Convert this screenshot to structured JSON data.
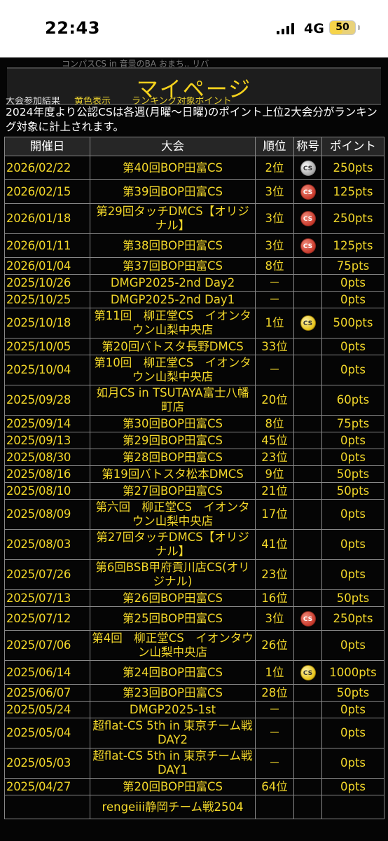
{
  "status_bar": {
    "time": "22:43",
    "network": "4G",
    "battery": "50",
    "battery_level": 0.5
  },
  "page": {
    "ghost_text": "コンパスCS in 音景のBA おまち.. リバ",
    "title": "マイページ",
    "legend": {
      "prefix": "大会参加結果",
      "yellow_label": "黄色表示",
      "ranking_label": "ランキング対象ポイント"
    },
    "notice": "2024年度より公認CSは各週(月曜～日曜)のポイント上位2大会分がランキング対象に計上されます。"
  },
  "table": {
    "headers": [
      "開催日",
      "大会",
      "順位",
      "称号",
      "ポイント"
    ],
    "rows": [
      {
        "date": "2026/02/22",
        "event": "第40回BOP田富CS",
        "rank": "2位",
        "badge": "silver",
        "badge_text": "CS",
        "points": "250pts"
      },
      {
        "date": "2026/02/15",
        "event": "第39回BOP田富CS",
        "rank": "3位",
        "badge": "bronze",
        "badge_text": "CS",
        "points": "125pts"
      },
      {
        "date": "2026/01/18",
        "event": "第29回タッチDMCS【オリジナル】",
        "rank": "3位",
        "badge": "bronze",
        "badge_text": "CS",
        "points": "250pts"
      },
      {
        "date": "2026/01/11",
        "event": "第38回BOP田富CS",
        "rank": "3位",
        "badge": "bronze",
        "badge_text": "CS",
        "points": "125pts"
      },
      {
        "date": "2026/01/04",
        "event": "第37回BOP田富CS",
        "rank": "8位",
        "badge": "",
        "badge_text": "",
        "points": "75pts"
      },
      {
        "date": "2025/10/26",
        "event": "DMGP2025-2nd Day2",
        "rank": "－",
        "badge": "",
        "badge_text": "",
        "points": "0pts"
      },
      {
        "date": "2025/10/25",
        "event": "DMGP2025-2nd Day1",
        "rank": "－",
        "badge": "",
        "badge_text": "",
        "points": "0pts"
      },
      {
        "date": "2025/10/18",
        "event": "第11回　柳正堂CS　イオンタウン山梨中央店",
        "rank": "1位",
        "badge": "gold",
        "badge_text": "CS",
        "points": "500pts"
      },
      {
        "date": "2025/10/05",
        "event": "第20回バトスタ長野DMCS",
        "rank": "33位",
        "badge": "",
        "badge_text": "",
        "points": "0pts"
      },
      {
        "date": "2025/10/04",
        "event": "第10回　柳正堂CS　イオンタウン山梨中央店",
        "rank": "－",
        "badge": "",
        "badge_text": "",
        "points": "0pts"
      },
      {
        "date": "2025/09/28",
        "event": "如月CS in TSUTAYA富士八幡町店",
        "rank": "20位",
        "badge": "",
        "badge_text": "",
        "points": "60pts"
      },
      {
        "date": "2025/09/14",
        "event": "第30回BOP田富CS",
        "rank": "8位",
        "badge": "",
        "badge_text": "",
        "points": "75pts"
      },
      {
        "date": "2025/09/13",
        "event": "第29回BOP田富CS",
        "rank": "45位",
        "badge": "",
        "badge_text": "",
        "points": "0pts"
      },
      {
        "date": "2025/08/30",
        "event": "第28回BOP田富CS",
        "rank": "23位",
        "badge": "",
        "badge_text": "",
        "points": "0pts"
      },
      {
        "date": "2025/08/16",
        "event": "第19回バトスタ松本DMCS",
        "rank": "9位",
        "badge": "",
        "badge_text": "",
        "points": "50pts"
      },
      {
        "date": "2025/08/10",
        "event": "第27回BOP田富CS",
        "rank": "21位",
        "badge": "",
        "badge_text": "",
        "points": "50pts"
      },
      {
        "date": "2025/08/09",
        "event": "第六回　柳正堂CS　イオンタウン山梨中央店",
        "rank": "17位",
        "badge": "",
        "badge_text": "",
        "points": "0pts"
      },
      {
        "date": "2025/08/03",
        "event": "第27回タッチDMCS【オリジナル】",
        "rank": "41位",
        "badge": "",
        "badge_text": "",
        "points": "0pts"
      },
      {
        "date": "2025/07/26",
        "event": "第6回BSB甲府貢川店CS(オリジナル)",
        "rank": "23位",
        "badge": "",
        "badge_text": "",
        "points": "0pts"
      },
      {
        "date": "2025/07/13",
        "event": "第26回BOP田富CS",
        "rank": "16位",
        "badge": "",
        "badge_text": "",
        "points": "50pts"
      },
      {
        "date": "2025/07/12",
        "event": "第25回BOP田富CS",
        "rank": "3位",
        "badge": "bronze",
        "badge_text": "CS",
        "points": "250pts"
      },
      {
        "date": "2025/07/06",
        "event": "第4回　柳正堂CS　イオンタウン山梨中央店",
        "rank": "26位",
        "badge": "",
        "badge_text": "",
        "points": "0pts"
      },
      {
        "date": "2025/06/14",
        "event": "第24回BOP田富CS",
        "rank": "1位",
        "badge": "gold",
        "badge_text": "CS",
        "points": "1000pts"
      },
      {
        "date": "2025/06/07",
        "event": "第23回BOP田富CS",
        "rank": "28位",
        "badge": "",
        "badge_text": "",
        "points": "50pts"
      },
      {
        "date": "2025/05/24",
        "event": "DMGP2025-1st",
        "rank": "－",
        "badge": "",
        "badge_text": "",
        "points": "0pts"
      },
      {
        "date": "2025/05/04",
        "event": "超flat-CS 5th in 東京チーム戦DAY2",
        "rank": "－",
        "badge": "",
        "badge_text": "",
        "points": "0pts"
      },
      {
        "date": "2025/05/03",
        "event": "超flat-CS 5th in 東京チーム戦DAY1",
        "rank": "－",
        "badge": "",
        "badge_text": "",
        "points": "0pts"
      },
      {
        "date": "2025/04/27",
        "event": "第20回BOP田富CS",
        "rank": "64位",
        "badge": "",
        "badge_text": "",
        "points": "0pts"
      },
      {
        "date": "",
        "event": "rengeiii静岡チーム戦2504",
        "rank": "",
        "badge": "",
        "badge_text": "",
        "points": ""
      }
    ]
  }
}
